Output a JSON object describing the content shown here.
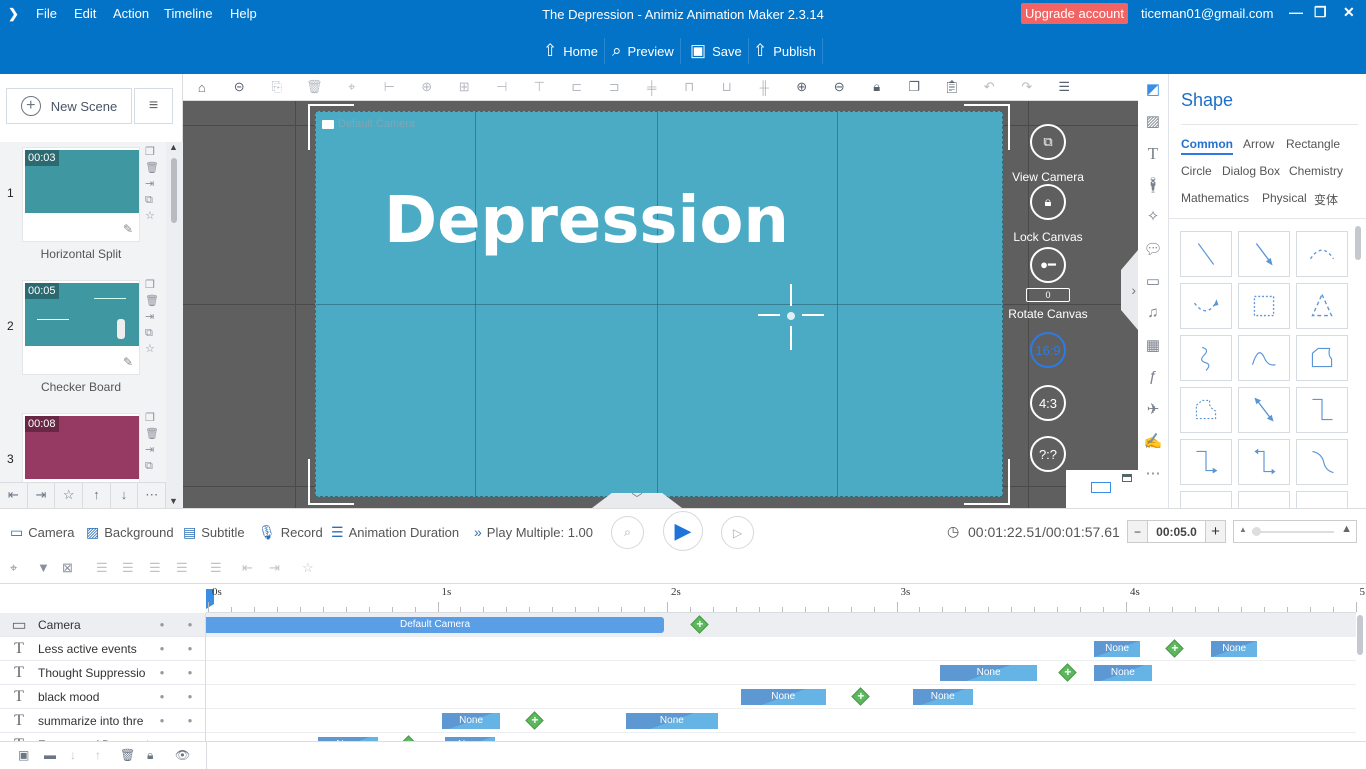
{
  "titlebar": {
    "menus": [
      "File",
      "Edit",
      "Action",
      "Timeline",
      "Help"
    ],
    "title": "The Depression - Animiz Animation Maker 2.3.14",
    "upgrade_label": "Upgrade account",
    "email": "ticeman01@gmail.com",
    "nav": [
      {
        "label": "Home",
        "icon": "home-icon"
      },
      {
        "label": "Preview",
        "icon": "preview-icon"
      },
      {
        "label": "Save",
        "icon": "save-icon"
      },
      {
        "label": "Publish",
        "icon": "publish-icon"
      }
    ]
  },
  "scenes": {
    "new_scene_label": "New Scene",
    "items": [
      {
        "num": "1",
        "duration": "00:03",
        "name": "Horizontal Split",
        "color": "#3f97a1"
      },
      {
        "num": "2",
        "duration": "00:05",
        "name": "Checker Board",
        "color": "#3f97a1"
      },
      {
        "num": "3",
        "duration": "00:08",
        "name": "",
        "color": "#963a63"
      }
    ]
  },
  "canvas": {
    "camera_label": "Default Camera",
    "title_text": "Depression",
    "bg_color": "#4babc5",
    "view_camera_label": "View Camera",
    "lock_canvas_label": "Lock Canvas",
    "rotate_canvas_label": "Rotate Canvas",
    "rotate_value": "0",
    "ratios": [
      "16:9",
      "4:3",
      "?:?"
    ],
    "active_ratio": "16:9"
  },
  "shape_panel": {
    "title": "Shape",
    "categories": [
      "Common",
      "Arrow",
      "Rectangle",
      "Circle",
      "Dialog Box",
      "Chemistry",
      "Mathematics",
      "Physical",
      "变体"
    ],
    "active_category": "Common"
  },
  "controls": {
    "camera": "Camera",
    "background": "Background",
    "subtitle": "Subtitle",
    "record": "Record",
    "animation_duration": "Animation Duration",
    "play_multiple": "Play Multiple: 1.00",
    "time": "00:01:22.51/00:01:57.61",
    "step_value": "00:05.0",
    "minus": "−",
    "plus": "+"
  },
  "timeline": {
    "ruler_labels": [
      "0s",
      "1s",
      "2s",
      "3s",
      "4s",
      "5"
    ],
    "tracks": [
      {
        "name": "Camera",
        "icon": "camera-icon"
      },
      {
        "name": "Less active events",
        "icon": "text-icon"
      },
      {
        "name": "Thought Suppressio",
        "icon": "text-icon"
      },
      {
        "name": "black mood",
        "icon": "text-icon"
      },
      {
        "name": "summarize into thre",
        "icon": "text-icon"
      },
      {
        "name": "Features of Depressio",
        "icon": "text-icon"
      }
    ],
    "camera_clip_label": "Default Camera",
    "clip_label": "None"
  }
}
